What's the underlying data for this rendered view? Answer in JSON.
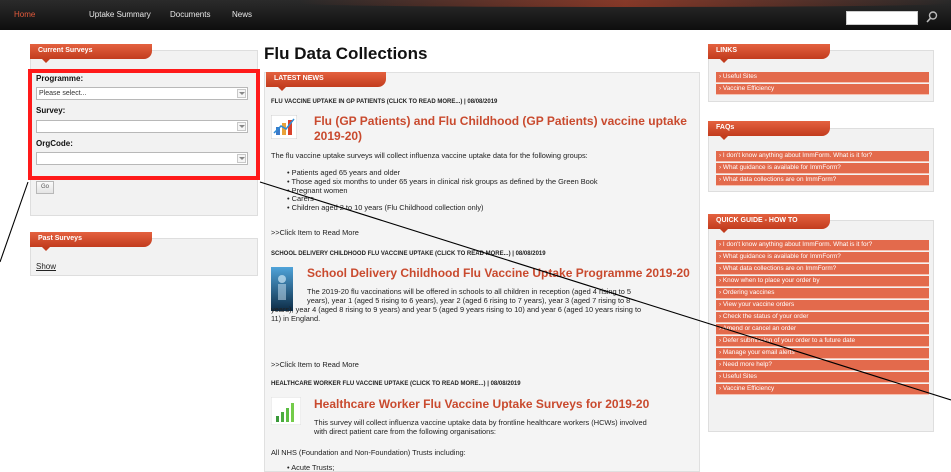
{
  "nav": {
    "items": [
      "Home",
      "Uptake Summary",
      "Documents",
      "News"
    ],
    "search": {
      "value": ""
    }
  },
  "current_surveys": {
    "header": "Current Surveys",
    "programme_label": "Programme:",
    "programme_value": "Please select...",
    "survey_label": "Survey:",
    "survey_value": "",
    "orgcode_label": "OrgCode:",
    "orgcode_value": "",
    "go_label": "Go"
  },
  "past_surveys": {
    "header": "Past Surveys",
    "show_label": "Show"
  },
  "main": {
    "title": "Flu Data Collections",
    "latest_news_header": "LATEST NEWS",
    "news": [
      {
        "head": "FLU VACCINE UPTAKE IN GP PATIENTS (CLICK TO READ MORE...) | 08/08/2019",
        "title": "Flu (GP Patients) and Flu Childhood (GP Patients) vaccine uptake 2019-20)",
        "body": "The flu vaccine uptake surveys will collect influenza vaccine uptake data for the following groups:",
        "bullets": [
          "Patients aged 65 years and older",
          "Those aged six months to under 65 years in clinical risk groups as defined by the Green Book",
          "Pregnant women",
          "Carers",
          "Children aged 2 to 10 years (Flu Childhood collection only)"
        ],
        "read_more": ">>Click Item to Read More"
      },
      {
        "head": "SCHOOL DELIVERY CHILDHOOD FLU VACCINE UPTAKE (CLICK TO READ MORE...) | 08/08/2019",
        "title": "School Delivery Childhood Flu Vaccine Uptake Programme 2019-20",
        "body_lines": [
          "The 2019-20 flu vaccinations will be offered in schools to all children in reception (aged 4 rising to 5",
          "years), year 1 (aged 5 rising to 6 years), year 2 (aged 6 rising to 7 years), year 3 (aged 7 rising to 8",
          "years), year 4 (aged 8 rising to 9 years) and year 5 (aged 9 years rising to 10) and year 6 (aged 10 years rising to",
          "11) in England."
        ],
        "read_more": ">>Click Item to Read More"
      },
      {
        "head": "HEALTHCARE WORKER FLU VACCINE UPTAKE (CLICK TO READ MORE...) | 08/08/2019",
        "title": "Healthcare Worker Flu Vaccine Uptake Surveys for 2019-20",
        "body_lines": [
          "This survey will collect influenza vaccine uptake data by frontline healthcare workers (HCWs) involved",
          "with direct patient care from the following organisations:"
        ],
        "extra": "All NHS (Foundation and Non-Foundation) Trusts including:",
        "bullets": [
          "Acute Trusts;"
        ]
      }
    ]
  },
  "links": {
    "header": "LINKS",
    "items": [
      "Useful Sites",
      "Vaccine Efficiency"
    ]
  },
  "faqs": {
    "header": "FAQs",
    "items": [
      "I don't know anything about ImmForm. What is it for?",
      "What guidance is available for ImmForm?",
      "What data collections are on ImmForm?"
    ]
  },
  "quick_guide": {
    "header": "QUICK GUIDE - HOW TO",
    "items": [
      "I don't know anything about ImmForm. What is it for?",
      "What guidance is available for ImmForm?",
      "What data collections are on ImmForm?",
      "Know when to place your order by",
      "Ordering vaccines",
      "View your vaccine orders",
      "Check the status of your order",
      "Amend or cancel an order",
      "Defer submission of your order to a future date",
      "Manage your email alerts",
      "Need more help?",
      "Useful Sites",
      "Vaccine Efficiency"
    ]
  },
  "colors": {
    "accent": "#c94a2e",
    "highlight": "#ff1a1a",
    "link_bg": "#e36a4c"
  }
}
